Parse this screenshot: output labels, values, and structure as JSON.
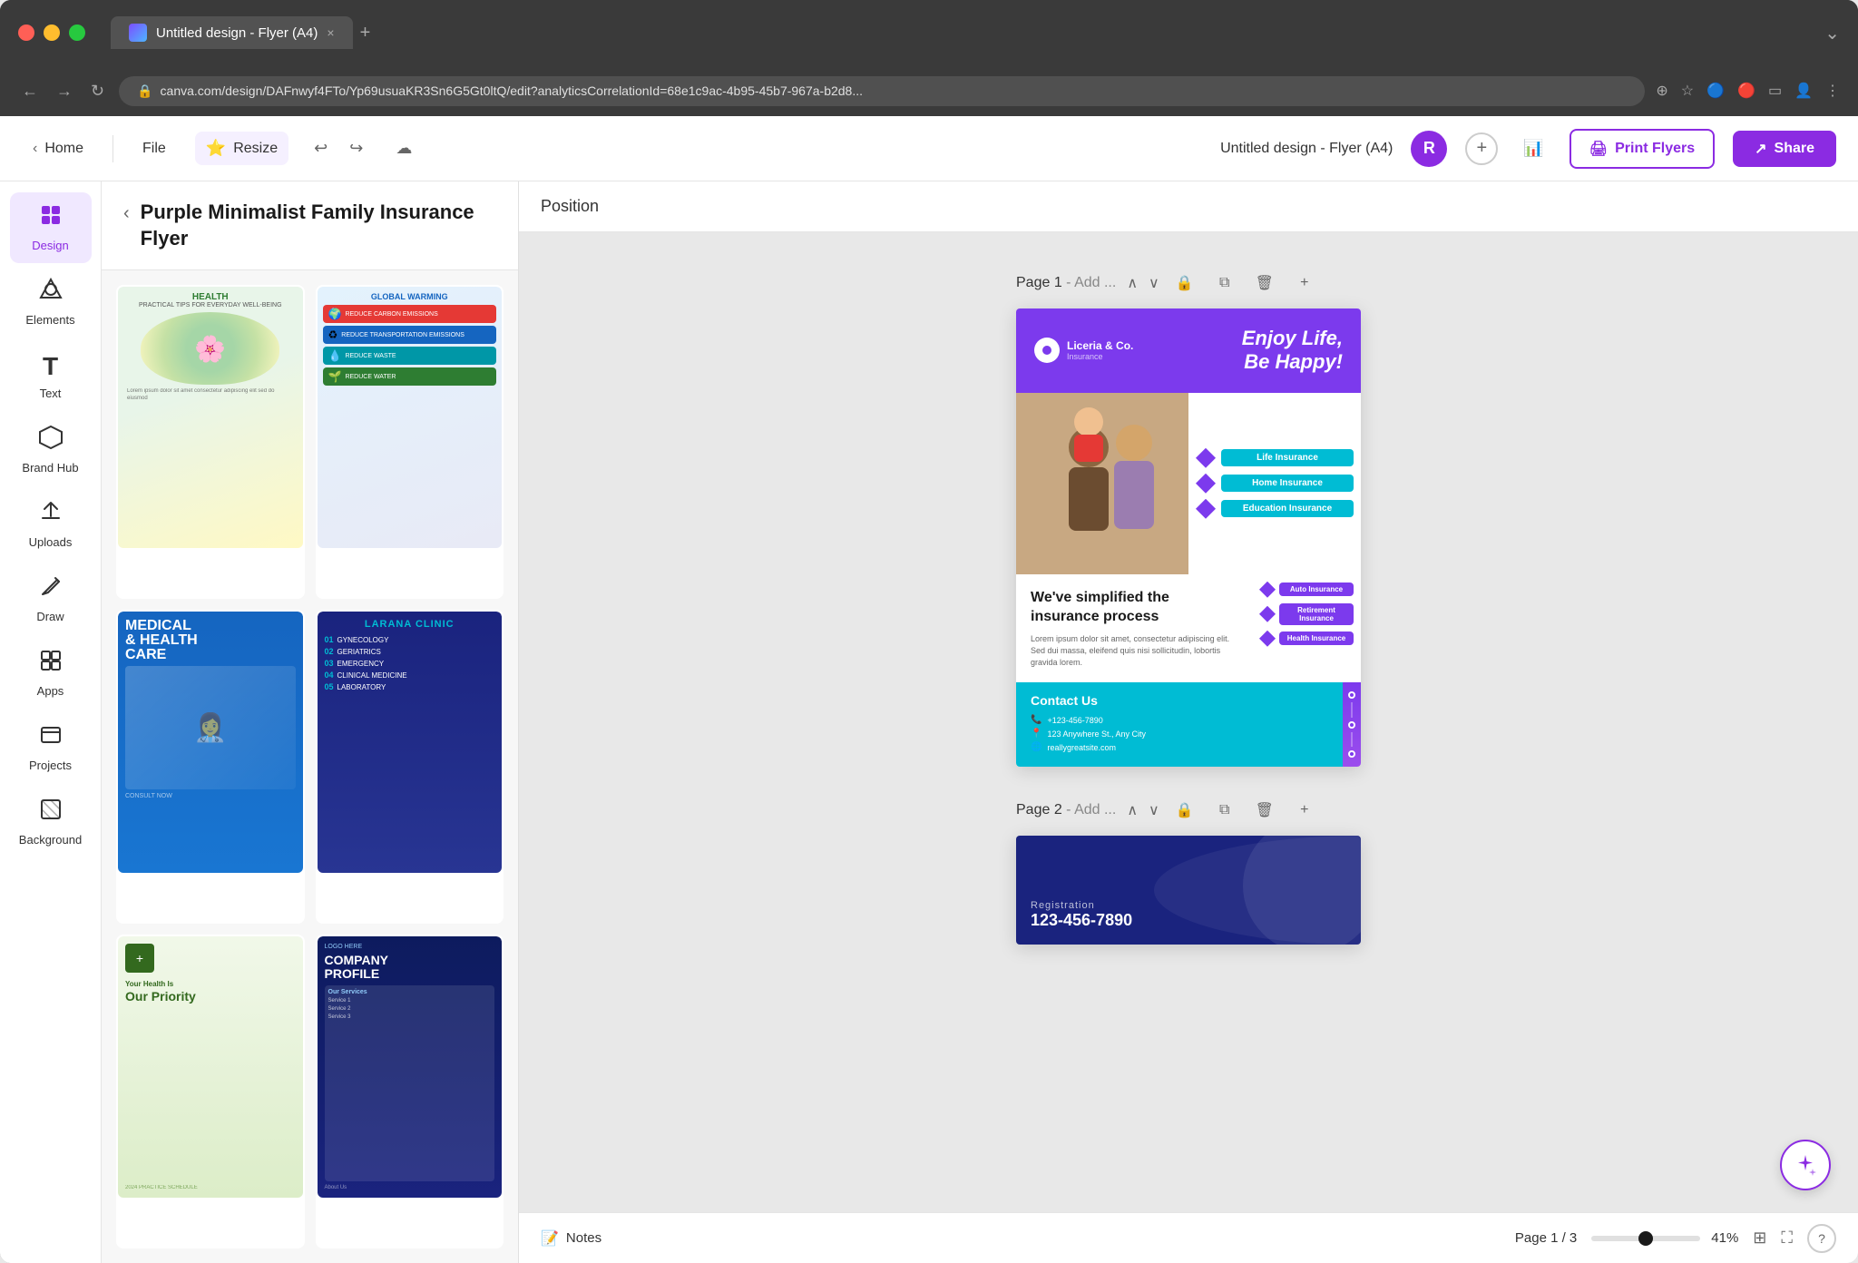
{
  "browser": {
    "tab_title": "Untitled design - Flyer (A4)",
    "tab_close": "×",
    "tab_new": "+",
    "address": "canva.com/design/DAFnwyf4FTo/Yp69usuaKR3Sn6G5Gt0ltQ/edit?analyticsCorrelationId=68e1c9ac-4b95-45b7-967a-b2d8..."
  },
  "topbar": {
    "home_label": "Home",
    "file_label": "File",
    "resize_label": "Resize",
    "design_title": "Untitled design - Flyer (A4)",
    "avatar_letter": "R",
    "print_label": "Print Flyers",
    "share_label": "Share"
  },
  "sidebar": {
    "items": [
      {
        "id": "design",
        "label": "Design",
        "icon": "⊞",
        "active": true
      },
      {
        "id": "elements",
        "label": "Elements",
        "icon": "✦"
      },
      {
        "id": "text",
        "label": "Text",
        "icon": "T"
      },
      {
        "id": "brand",
        "label": "Brand Hub",
        "icon": "⬡"
      },
      {
        "id": "uploads",
        "label": "Uploads",
        "icon": "↑"
      },
      {
        "id": "draw",
        "label": "Draw",
        "icon": "✏"
      },
      {
        "id": "apps",
        "label": "Apps",
        "icon": "⊞"
      },
      {
        "id": "projects",
        "label": "Projects",
        "icon": "□"
      },
      {
        "id": "background",
        "label": "Background",
        "icon": "▦"
      }
    ]
  },
  "template_panel": {
    "back_button": "‹",
    "title": "Purple Minimalist Family Insurance Flyer",
    "templates": [
      {
        "id": "health-brain",
        "title": "HEALTH"
      },
      {
        "id": "global-warming",
        "title": "GLOBAL WARMING"
      },
      {
        "id": "medical-health",
        "title": "MEDICAL & HEALTH CARE"
      },
      {
        "id": "larana-clinic",
        "title": "LARANA CLINIC"
      },
      {
        "id": "health-priority",
        "title": "Your Health Is Our Priority"
      },
      {
        "id": "company-profile",
        "title": "COMPANY PROFILE"
      }
    ]
  },
  "canvas": {
    "position_label": "Position",
    "page1_label": "Page 1",
    "page1_add": "- Add ...",
    "page2_label": "Page 2",
    "page2_add": "- Add ..."
  },
  "flyer": {
    "logo_name": "Liceria & Co.",
    "logo_sub": "Insurance",
    "tagline_line1": "Enjoy Life,",
    "tagline_line2": "Be Happy!",
    "services": [
      {
        "label": "Life\nInsurance"
      },
      {
        "label": "Home\nInsurance"
      },
      {
        "label": "Education\nInsurance"
      },
      {
        "label": "Auto\nInsurance"
      },
      {
        "label": "Retirement\nInsurance"
      },
      {
        "label": "Health\nInsurance"
      }
    ],
    "simplified_title": "We've simplified the insurance process",
    "simplified_body": "Lorem ipsum dolor sit amet, consectetur adipiscing elit. Sed dui massa, eleifend quis nisi sollicitudin, lobortis gravida lorem.",
    "contact_title": "Contact Us",
    "phone": "+123-456-7890",
    "address": "123 Anywhere St., Any City",
    "website": "reallygreatsite.com"
  },
  "page2": {
    "reg_label": "Registration",
    "number": "123-456-7890"
  },
  "bottom_bar": {
    "notes_label": "Notes",
    "page_indicator": "Page 1 / 3",
    "zoom_percent": "41%"
  }
}
